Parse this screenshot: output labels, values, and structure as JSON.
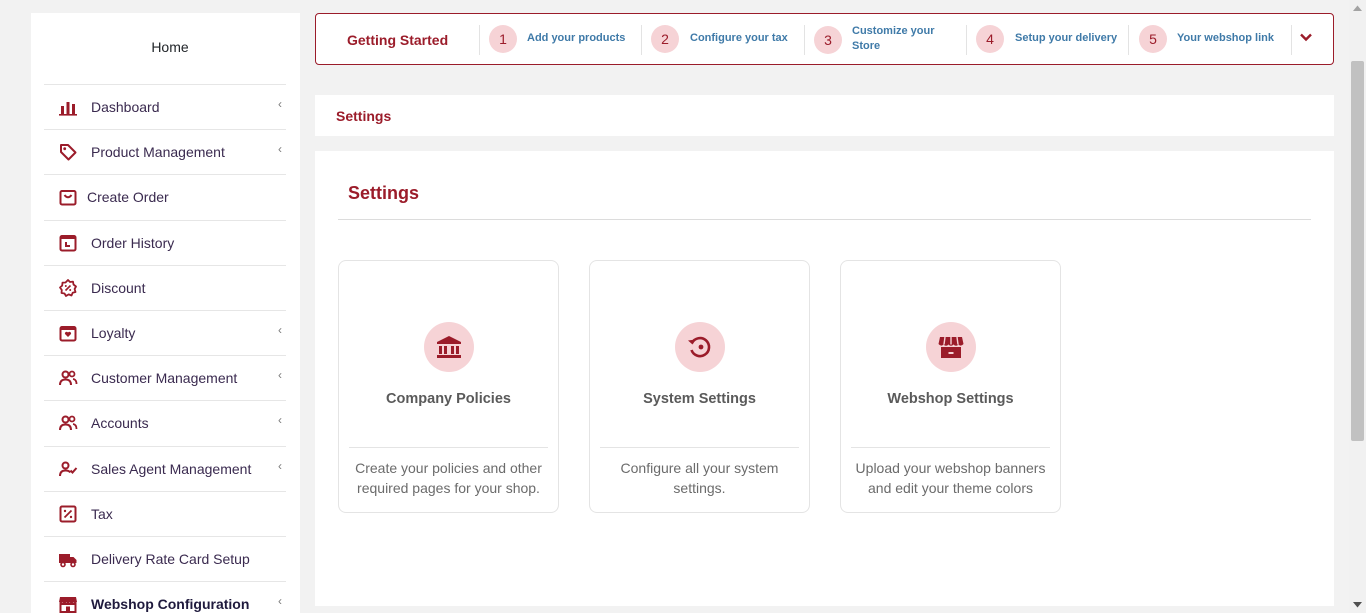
{
  "sidebar": {
    "home_label": "Home",
    "items": [
      {
        "label": "Dashboard",
        "icon": "bar-chart-icon",
        "has_submenu": true
      },
      {
        "label": "Product Management",
        "icon": "tag-icon",
        "has_submenu": true
      },
      {
        "label": "Create Order",
        "icon": "shopping-bag-icon",
        "has_submenu": false
      },
      {
        "label": "Order History",
        "icon": "calendar-clock-icon",
        "has_submenu": false
      },
      {
        "label": "Discount",
        "icon": "discount-badge-icon",
        "has_submenu": false
      },
      {
        "label": "Loyalty",
        "icon": "gift-icon",
        "has_submenu": true
      },
      {
        "label": "Customer Management",
        "icon": "users-icon",
        "has_submenu": true
      },
      {
        "label": "Accounts",
        "icon": "users-icon",
        "has_submenu": true
      },
      {
        "label": "Sales Agent Management",
        "icon": "user-check-icon",
        "has_submenu": true
      },
      {
        "label": "Tax",
        "icon": "percent-icon",
        "has_submenu": false
      },
      {
        "label": "Delivery Rate Card Setup",
        "icon": "truck-icon",
        "has_submenu": false
      },
      {
        "label": "Webshop Configuration",
        "icon": "storefront-icon",
        "has_submenu": true,
        "active": true
      }
    ]
  },
  "stepper": {
    "title": "Getting Started",
    "steps": [
      {
        "number": "1",
        "label": "Add your products"
      },
      {
        "number": "2",
        "label": "Configure your tax"
      },
      {
        "number": "3",
        "label_line1": "Customize your",
        "label_line2": "Store"
      },
      {
        "number": "4",
        "label": "Setup your delivery"
      },
      {
        "number": "5",
        "label": "Your webshop link"
      }
    ],
    "toggle_icon": "chevron-down-icon"
  },
  "breadcrumb": {
    "label": "Settings"
  },
  "main": {
    "title": "Settings",
    "cards": [
      {
        "title": "Company Policies",
        "description": "Create your policies and other required pages for your shop.",
        "icon": "bank-icon"
      },
      {
        "title": "System Settings",
        "description": "Configure all your system settings.",
        "icon": "history-icon"
      },
      {
        "title": "Webshop Settings",
        "description": "Upload your webshop banners and edit your theme colors",
        "icon": "storefront-icon"
      }
    ]
  },
  "colors": {
    "brand": "#9b1c2a",
    "brand_light": "#f6d3d6",
    "link": "#3f7aa8",
    "background": "#f2f2f2"
  }
}
